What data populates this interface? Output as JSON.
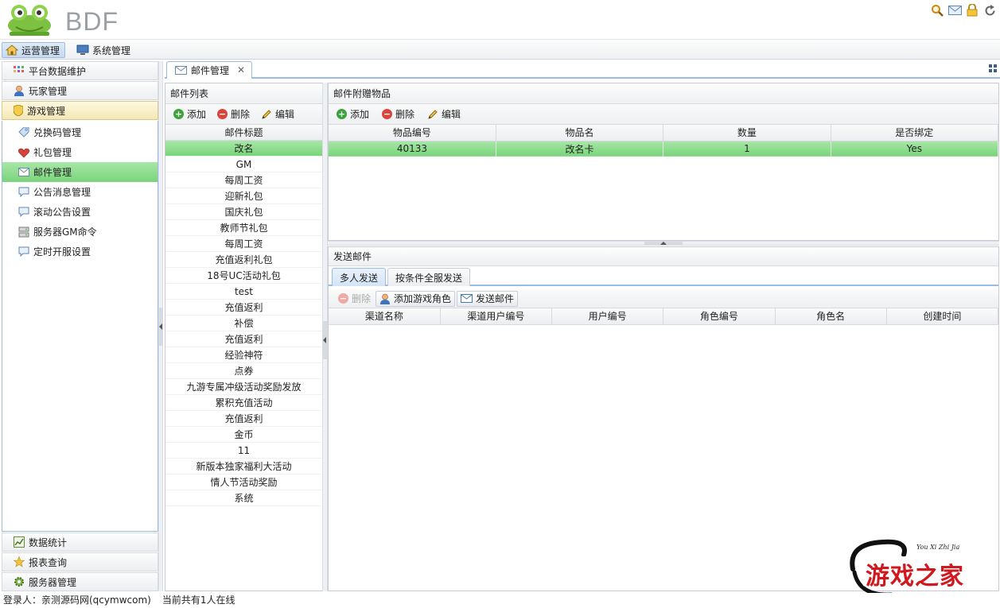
{
  "header": {
    "app_title": "BDF",
    "icons": [
      "search-icon",
      "mail-icon",
      "lock-icon",
      "refresh-icon"
    ]
  },
  "topnav": {
    "items": [
      {
        "label": "运营管理",
        "icon": "home-icon",
        "active": true
      },
      {
        "label": "系统管理",
        "icon": "monitor-icon",
        "active": false
      }
    ]
  },
  "sidebar": {
    "sections_top": [
      {
        "label": "平台数据维护",
        "icon": "grid-icon"
      },
      {
        "label": "玩家管理",
        "icon": "user-icon"
      },
      {
        "label": "游戏管理",
        "icon": "shield-icon"
      }
    ],
    "game_items": [
      {
        "label": "兑换码管理",
        "icon": "tag-icon"
      },
      {
        "label": "礼包管理",
        "icon": "gift-icon"
      },
      {
        "label": "邮件管理",
        "icon": "mail-icon",
        "selected": true
      },
      {
        "label": "公告消息管理",
        "icon": "chat-icon"
      },
      {
        "label": "滚动公告设置",
        "icon": "chat-icon"
      },
      {
        "label": "服务器GM命令",
        "icon": "server-icon"
      },
      {
        "label": "定时开服设置",
        "icon": "chat-icon"
      }
    ],
    "sections_bottom": [
      {
        "label": "数据统计",
        "icon": "chart-icon"
      },
      {
        "label": "报表查询",
        "icon": "star-icon"
      },
      {
        "label": "服务器管理",
        "icon": "gear-icon"
      }
    ]
  },
  "tabs": {
    "active_tab": "邮件管理"
  },
  "mail_list": {
    "title": "邮件列表",
    "toolbar": {
      "add": "添加",
      "delete": "删除",
      "edit": "编辑"
    },
    "column": "邮件标题",
    "rows": [
      "改名",
      "GM",
      "每周工资",
      "迎新礼包",
      "国庆礼包",
      "教师节礼包",
      "每周工资",
      "充值返利礼包",
      "18号UC活动礼包",
      "test",
      "充值返利",
      "补偿",
      "充值返利",
      "经验神符",
      "点券",
      "九游专属冲级活动奖励发放",
      "累积充值活动",
      "充值返利",
      "金币",
      "11",
      "新版本独家福利大活动",
      "情人节活动奖励",
      "系统"
    ],
    "selected_index": 0
  },
  "attachments": {
    "title": "邮件附赠物品",
    "toolbar": {
      "add": "添加",
      "delete": "删除",
      "edit": "编辑"
    },
    "columns": [
      "物品编号",
      "物品名",
      "数量",
      "是否绑定"
    ],
    "rows": [
      [
        "40133",
        "改名卡",
        "1",
        "Yes"
      ]
    ]
  },
  "send_mail": {
    "title": "发送邮件",
    "subtabs": [
      "多人发送",
      "按条件全服发送"
    ],
    "toolbar": {
      "delete": "删除",
      "add_role": "添加游戏角色",
      "send": "发送邮件"
    },
    "columns": [
      "渠道名称",
      "渠道用户编号",
      "用户编号",
      "角色编号",
      "角色名",
      "创建时间"
    ]
  },
  "statusbar": {
    "login": "登录人：亲测源码网(qcymwcom)",
    "online": "当前共有1人在线"
  },
  "watermark": {
    "text": "游戏之家",
    "pinyin": "You Xi Zhi Jia"
  },
  "colors": {
    "selected_green": "#8fdc8f",
    "panel_border": "#99bbe8",
    "add_green": "#3aa33a",
    "delete_red": "#d9453b"
  }
}
